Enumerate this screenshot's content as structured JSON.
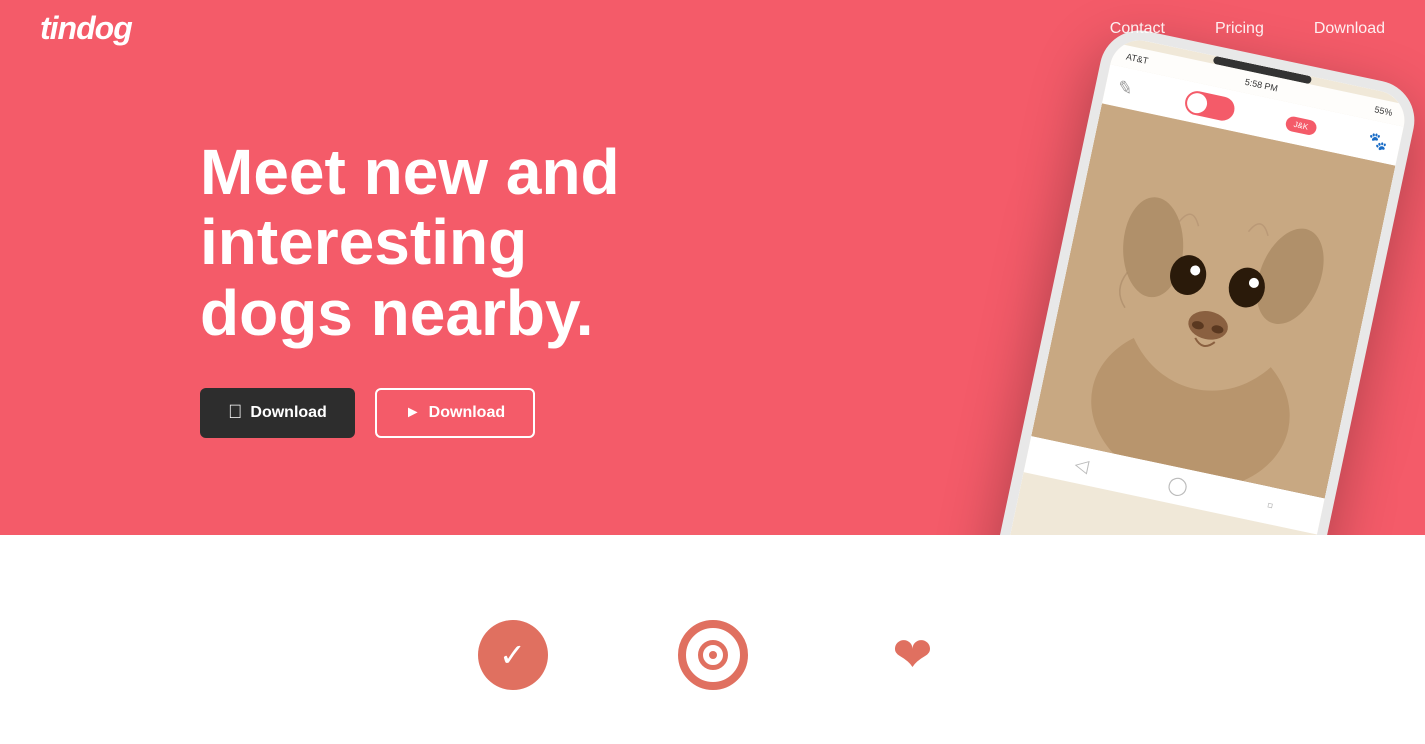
{
  "nav": {
    "logo": "tindog",
    "links": [
      {
        "label": "Contact",
        "href": "#contact"
      },
      {
        "label": "Pricing",
        "href": "#pricing"
      },
      {
        "label": "Download",
        "href": "#download"
      }
    ]
  },
  "hero": {
    "title": "Meet new and interesting dogs nearby.",
    "btn_apple_label": "Download",
    "btn_google_label": "Download",
    "apple_icon": "",
    "google_icon": "▷"
  },
  "phone": {
    "status_carrier": "AT&T",
    "status_time": "5:58 PM",
    "status_battery": "55%",
    "tag_label": "J&K"
  },
  "lower": {
    "icons": [
      {
        "type": "check",
        "label": ""
      },
      {
        "type": "target",
        "label": ""
      },
      {
        "type": "heart",
        "label": ""
      }
    ]
  }
}
